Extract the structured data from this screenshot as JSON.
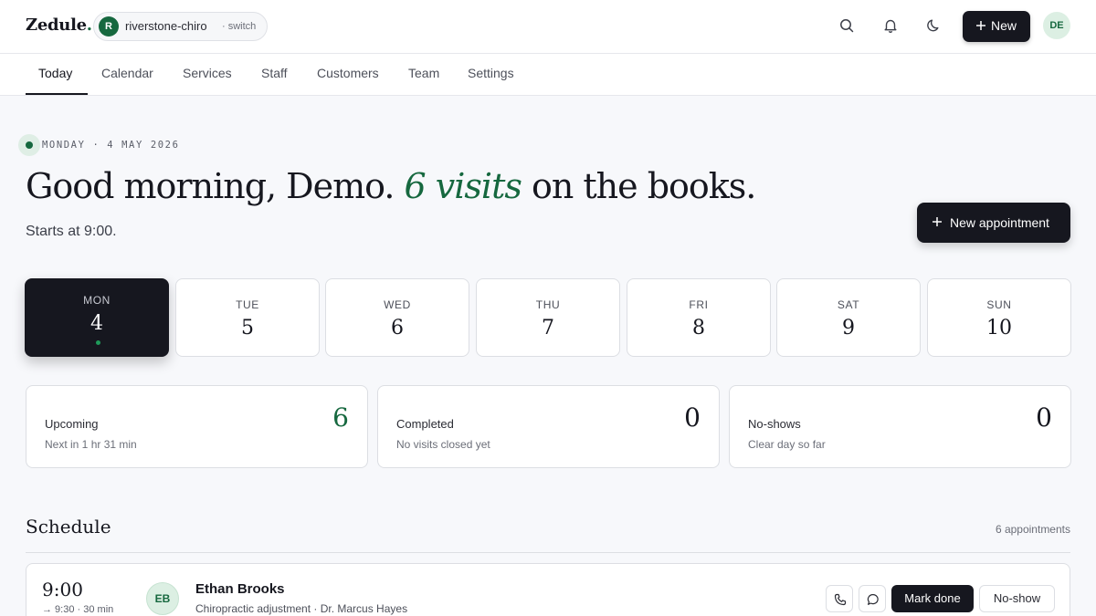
{
  "app": {
    "logo": "Zedule",
    "logo_dot": "."
  },
  "workspace": {
    "initial": "R",
    "name": "riverstone-chiro",
    "switch": "· switch"
  },
  "header": {
    "new_label": "New",
    "user_initials": "DE",
    "icons": [
      "search-icon",
      "bell-icon",
      "moon-icon",
      "plus-icon"
    ]
  },
  "tabs": [
    {
      "label": "Today",
      "active": true
    },
    {
      "label": "Calendar"
    },
    {
      "label": "Services"
    },
    {
      "label": "Staff"
    },
    {
      "label": "Customers"
    },
    {
      "label": "Team"
    },
    {
      "label": "Settings"
    }
  ],
  "today": {
    "date_text": "MONDAY · 4 MAY 2026",
    "greeting": "Good morning, Demo.",
    "visits": "6 visits",
    "suffix": "on the books.",
    "starts": "Starts at 9:00.",
    "new_appointment": "New appointment"
  },
  "days": [
    {
      "name": "MON",
      "num": "4",
      "active": true
    },
    {
      "name": "TUE",
      "num": "5"
    },
    {
      "name": "WED",
      "num": "6"
    },
    {
      "name": "THU",
      "num": "7"
    },
    {
      "name": "FRI",
      "num": "8"
    },
    {
      "name": "SAT",
      "num": "9"
    },
    {
      "name": "SUN",
      "num": "10"
    }
  ],
  "stats": [
    {
      "title": "Upcoming",
      "desc": "Next in 1 hr 31 min",
      "value": "6"
    },
    {
      "title": "Completed",
      "desc": "No visits closed yet",
      "value": "0"
    },
    {
      "title": "No-shows",
      "desc": "Clear day so far",
      "value": "0"
    }
  ],
  "schedule": {
    "title": "Schedule",
    "count": "6 appointments",
    "rows": [
      {
        "time": "9:00",
        "range": "→ 9:30 · 30 min",
        "initials": "EB",
        "name": "Ethan Brooks",
        "service": "Chiropractic adjustment  ·  Dr. Marcus Hayes",
        "done": "Mark done",
        "noshow": "No-show"
      }
    ]
  },
  "colors": {
    "accent": "#16683f",
    "dark": "#16171f",
    "background": "#f7f8fb"
  }
}
